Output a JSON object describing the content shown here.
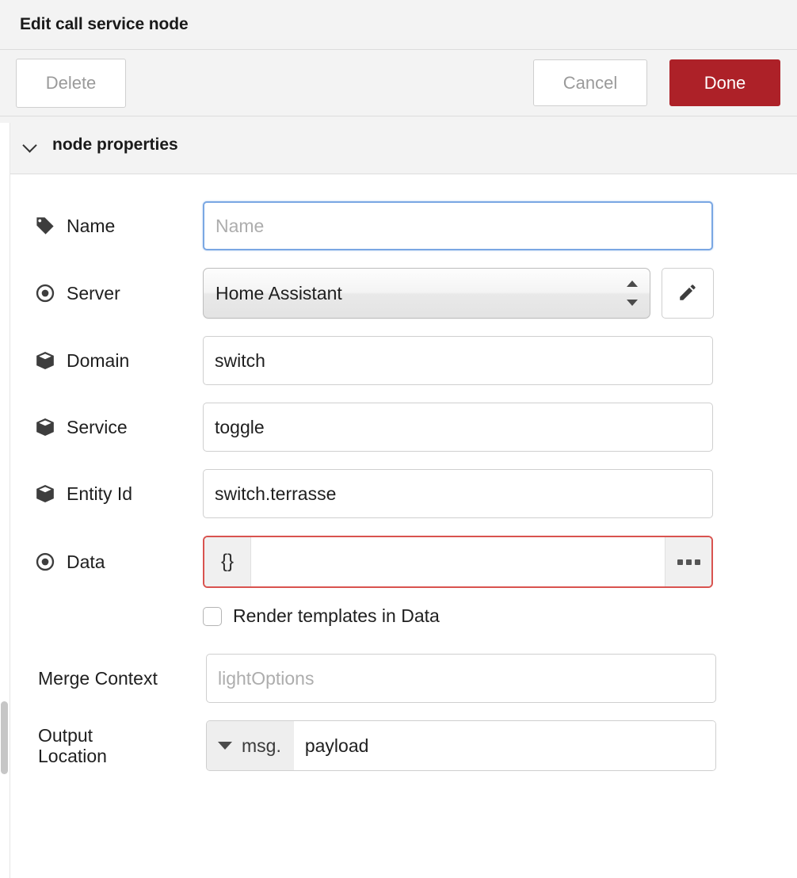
{
  "dialog": {
    "title": "Edit call service node"
  },
  "toolbar": {
    "delete_label": "Delete",
    "cancel_label": "Cancel",
    "done_label": "Done",
    "done_color": "#ad2128"
  },
  "section": {
    "title": "node properties",
    "chevron_icon": "chevron-down-icon",
    "expanded": true
  },
  "fields": {
    "name": {
      "label": "Name",
      "icon": "tag-icon",
      "value": "",
      "placeholder": "Name",
      "focused": true
    },
    "server": {
      "label": "Server",
      "icon": "target-icon",
      "value": "Home Assistant",
      "edit_icon": "pencil-icon"
    },
    "domain": {
      "label": "Domain",
      "icon": "cube-icon",
      "value": "switch",
      "placeholder": ""
    },
    "service": {
      "label": "Service",
      "icon": "cube-icon",
      "value": "toggle",
      "placeholder": ""
    },
    "entity_id": {
      "label": "Entity Id",
      "icon": "cube-icon",
      "value": "switch.terrasse",
      "placeholder": ""
    },
    "data": {
      "label": "Data",
      "icon": "target-icon",
      "type_prefix": "{}",
      "value": "",
      "placeholder": "",
      "expand_icon": "ellipsis-icon",
      "error": true,
      "error_color": "#d9534f"
    },
    "render_templates": {
      "label": "Render templates in Data",
      "checked": false
    },
    "merge_context": {
      "label": "Merge Context",
      "value": "",
      "placeholder": "lightOptions"
    },
    "output_location": {
      "label": "Output\nLocation",
      "type": "msg.",
      "value": "payload",
      "caret_icon": "caret-down-icon"
    }
  },
  "scrollbar": {
    "present": true
  }
}
